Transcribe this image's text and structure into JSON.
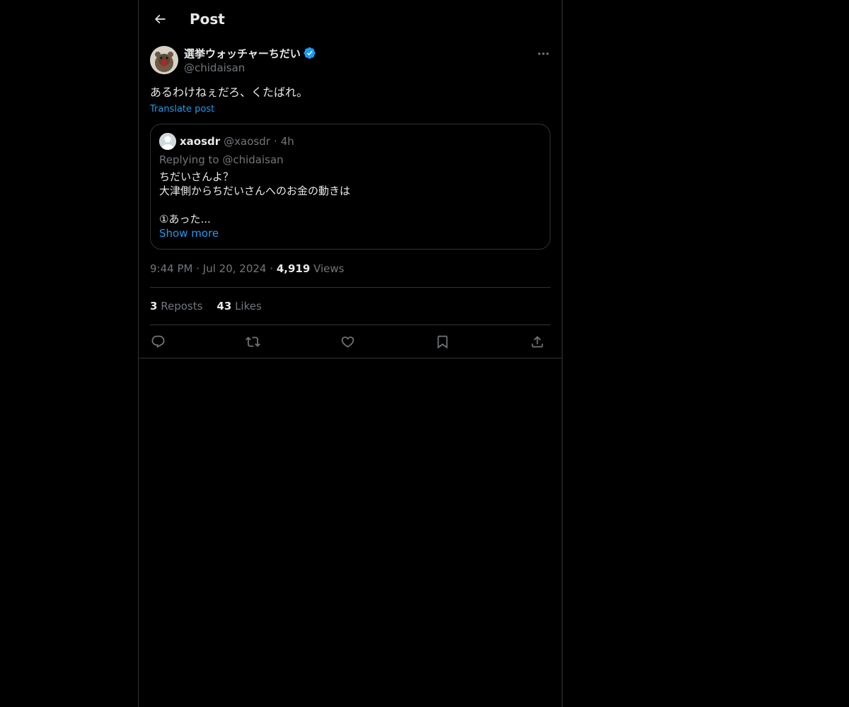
{
  "header": {
    "title": "Post",
    "back_icon": "arrow-left-icon"
  },
  "post": {
    "author_name": "選挙ウォッチャーちだい",
    "author_handle": "@chidaisan",
    "verified": true,
    "text": "あるわけねぇだろ、くたばれ。",
    "translate_label": "Translate post",
    "time": "9:44 PM",
    "date": "Jul 20, 2024",
    "views_count": "4,919",
    "views_label": "Views",
    "reposts_count": "3",
    "reposts_label": "Reposts",
    "likes_count": "43",
    "likes_label": "Likes"
  },
  "quote": {
    "name": "xaosdr",
    "handle": "@xaosdr",
    "separator": "·",
    "time": "4h",
    "replying_to": "Replying to @chidaisan",
    "lines": [
      "ちだいさんよ？",
      "大津側からちだいさんへのお金の動きは",
      "",
      "①あった..."
    ],
    "show_more": "Show more"
  },
  "meta_separator": "·",
  "actions": {
    "reply_icon": "reply-icon",
    "repost_icon": "repost-icon",
    "like_icon": "heart-icon",
    "bookmark_icon": "bookmark-icon",
    "share_icon": "share-icon"
  },
  "colors": {
    "background": "#000000",
    "text": "#e7e9ea",
    "muted": "#71767b",
    "accent": "#1d9bf0",
    "border": "#2f3336"
  }
}
